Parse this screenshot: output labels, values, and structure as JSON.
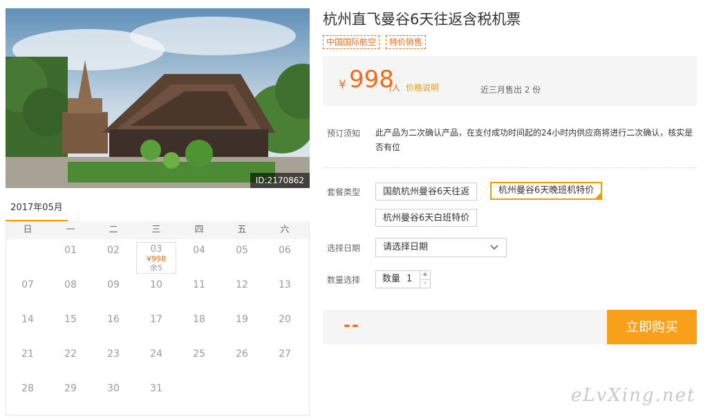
{
  "photo": {
    "id_label": "ID:2170862"
  },
  "calendar": {
    "month": "2017年05月",
    "weekdays": [
      "日",
      "一",
      "二",
      "三",
      "四",
      "五",
      "六"
    ],
    "available": {
      "day": "03",
      "price": "¥998",
      "remaining": "余5"
    }
  },
  "product": {
    "title": "杭州直飞曼谷6天往返含税机票",
    "tags": [
      "中国国际航空",
      "特价销售"
    ]
  },
  "price": {
    "symbol": "¥",
    "amount": "998",
    "unit": "/人",
    "explain_link": "价格说明",
    "sold": "近三月售出 2 份"
  },
  "notice": {
    "label": "预订须知",
    "text": "此产品为二次确认产品，在支付成功时间起的24小时内供应商将进行二次确认，核实是否有位"
  },
  "package": {
    "label": "套餐类型",
    "options": [
      "国航杭州曼谷6天往返",
      "杭州曼谷6天晚班机特价",
      "杭州曼谷6天白班特价"
    ],
    "selected_index": 1
  },
  "date": {
    "label": "选择日期",
    "placeholder": "请选择日期"
  },
  "quantity": {
    "label": "数量选择",
    "field_label": "数量",
    "value": "1",
    "plus": "+",
    "minus": "-"
  },
  "buy": {
    "total": "--",
    "button": "立即购买"
  },
  "watermark": "eLvXing.net",
  "colors": {
    "accent": "#f26a12",
    "button": "#f9a01b",
    "panel": "#f5f5f5"
  }
}
